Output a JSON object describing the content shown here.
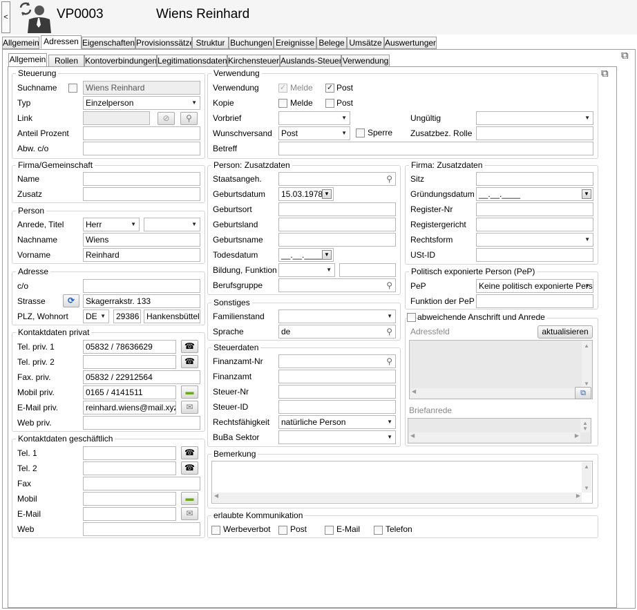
{
  "header": {
    "collapse_label": "<",
    "code": "VP0003",
    "name": "Wiens Reinhard"
  },
  "main_tabs": [
    "Allgemein",
    "Adressen",
    "Eigenschaften",
    "Provisionssätze",
    "Struktur",
    "Buchungen",
    "Ereignisse",
    "Belege",
    "Umsätze",
    "Auswertungen"
  ],
  "sub_tabs": [
    "Allgemein",
    "Rollen",
    "Kontoverbindungen",
    "Legitimationsdaten",
    "Kirchensteuer",
    "Auslands-Steuer",
    "Verwendung"
  ],
  "steuerung": {
    "title": "Steuerung",
    "suchname_label": "Suchname",
    "suchname_value": "Wiens Reinhard",
    "typ_label": "Typ",
    "typ_value": "Einzelperson",
    "link_label": "Link",
    "link_value": "",
    "anteil_label": "Anteil Prozent",
    "anteil_value": "",
    "abw_label": "Abw. c/o",
    "abw_value": ""
  },
  "firma_gemeinschaft": {
    "title": "Firma/Gemeinschaft",
    "name_label": "Name",
    "name_value": "",
    "zusatz_label": "Zusatz",
    "zusatz_value": ""
  },
  "person": {
    "title": "Person",
    "anrede_label": "Anrede, Titel",
    "anrede_value": "Herr",
    "titel_value": "",
    "nachname_label": "Nachname",
    "nachname_value": "Wiens",
    "vorname_label": "Vorname",
    "vorname_value": "Reinhard"
  },
  "adresse": {
    "title": "Adresse",
    "co_label": "c/o",
    "co_value": "",
    "strasse_label": "Strasse",
    "strasse_value": "Skagerrakstr. 133",
    "plz_label": "PLZ, Wohnort",
    "land_value": "DE",
    "plz_value": "29386",
    "ort_value": "Hankensbüttel"
  },
  "kontakt_privat": {
    "title": "Kontaktdaten privat",
    "tel1_label": "Tel. priv. 1",
    "tel1_value": "05832 / 78636629",
    "tel2_label": "Tel. priv. 2",
    "tel2_value": "",
    "fax_label": "Fax. priv.",
    "fax_value": "05832 / 22912564",
    "mobil_label": "Mobil priv.",
    "mobil_value": "0165 / 4141511",
    "email_label": "E-Mail priv.",
    "email_value": "reinhard.wiens@mail.xyz",
    "web_label": "Web priv.",
    "web_value": ""
  },
  "kontakt_geschaeftlich": {
    "title": "Kontaktdaten geschäftlich",
    "tel1_label": "Tel. 1",
    "tel2_label": "Tel. 2",
    "fax_label": "Fax",
    "mobil_label": "Mobil",
    "email_label": "E-Mail",
    "web_label": "Web"
  },
  "verwendung": {
    "title": "Verwendung",
    "verwendung_label": "Verwendung",
    "melde": "Melde",
    "post": "Post",
    "kopie_label": "Kopie",
    "vorbrief_label": "Vorbrief",
    "vorbrief_value": "",
    "wunschversand_label": "Wunschversand",
    "wunschversand_value": "Post",
    "sperre_label": "Sperre",
    "betreff_label": "Betreff",
    "betreff_value": "",
    "ungueltig_label": "Ungültig",
    "ungueltig_value": "",
    "zusatzrolle_label": "Zusatzbez. Rolle",
    "zusatzrolle_value": ""
  },
  "person_zusatz": {
    "title": "Person: Zusatzdaten",
    "staatsangeh_label": "Staatsangeh.",
    "geburtsdatum_label": "Geburtsdatum",
    "geburtsdatum_value": "15.03.1978",
    "geburtsort_label": "Geburtsort",
    "geburtsland_label": "Geburtsland",
    "geburtsname_label": "Geburtsname",
    "todesdatum_label": "Todesdatum",
    "todesdatum_value": "__.__.____",
    "bildung_label": "Bildung, Funktion",
    "berufsgruppe_label": "Berufsgruppe"
  },
  "firma_zusatz": {
    "title": "Firma: Zusatzdaten",
    "sitz_label": "Sitz",
    "gruendungsdatum_label": "Gründungsdatum",
    "gruendungsdatum_value": "__.__.____",
    "registernr_label": "Register-Nr",
    "registergericht_label": "Registergericht",
    "rechtsform_label": "Rechtsform",
    "ustid_label": "USt-ID"
  },
  "pep": {
    "title": "Politisch exponierte Person (PeP)",
    "pep_label": "PeP",
    "pep_value": "Keine politisch exponierte Person",
    "funktion_label": "Funktion der PeP"
  },
  "sonstiges": {
    "title": "Sonstiges",
    "familienstand_label": "Familienstand",
    "sprache_label": "Sprache",
    "sprache_value": "de"
  },
  "anschrift": {
    "checkbox_label": "abweichende Anschrift und Anrede",
    "adressfeld_label": "Adressfeld",
    "aktualisieren_label": "aktualisieren",
    "briefanrede_label": "Briefanrede"
  },
  "steuerdaten": {
    "title": "Steuerdaten",
    "finanzamtnr_label": "Finanzamt-Nr",
    "finanzamt_label": "Finanzamt",
    "steuernr_label": "Steuer-Nr",
    "steuerid_label": "Steuer-ID",
    "rechtsfaehigkeit_label": "Rechtsfähigkeit",
    "rechtsfaehigkeit_value": "natürliche Person",
    "buba_label": "BuBa Sektor"
  },
  "bemerkung": {
    "title": "Bemerkung"
  },
  "kommunikation": {
    "title": "erlaubte Kommunikation",
    "werbeverbot": "Werbeverbot",
    "post": "Post",
    "email": "E-Mail",
    "telefon": "Telefon"
  }
}
